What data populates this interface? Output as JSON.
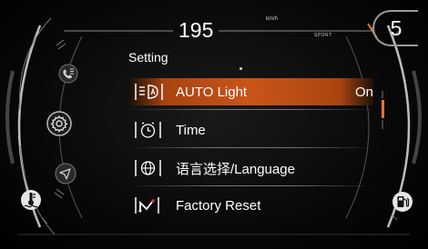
{
  "dashboard": {
    "speed": "195",
    "speed_unit": "km/h",
    "drive_mode": "SPORT",
    "gear": "5"
  },
  "menu": {
    "title": "Setting",
    "items": [
      {
        "label": "AUTO Light",
        "value": "On",
        "icon": "auto-light-icon",
        "selected": true
      },
      {
        "label": "Time",
        "value": "",
        "icon": "clock-icon",
        "selected": false
      },
      {
        "label": "语言选择/Language",
        "value": "",
        "icon": "globe-icon",
        "selected": false
      },
      {
        "label": "Factory Reset",
        "value": "",
        "icon": "factory-reset-icon",
        "selected": false
      }
    ]
  },
  "side_icons": [
    "phone-menu-icon",
    "settings-gear-icon",
    "navigation-arrow-icon",
    "coolant-temperature-icon",
    "fuel-pump-icon"
  ],
  "colors": {
    "highlight": "#c9551a",
    "highlight_edge": "#a94410",
    "gauge_accent": "#e8742c",
    "text": "#ffffff",
    "background": "#000000"
  }
}
